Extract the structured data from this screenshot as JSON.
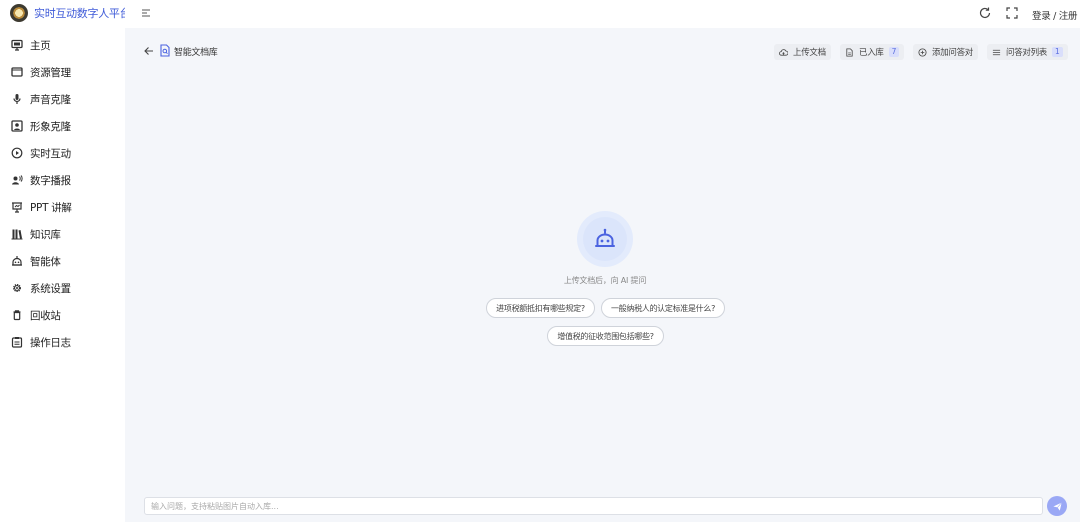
{
  "brand": {
    "name": "实时互动数字人平台",
    "color": "#3f5bd8"
  },
  "sidebar": {
    "items": [
      {
        "label": "主页",
        "icon": "monitor-icon"
      },
      {
        "label": "资源管理",
        "icon": "folder-icon"
      },
      {
        "label": "声音克隆",
        "icon": "microphone-icon"
      },
      {
        "label": "形象克隆",
        "icon": "portrait-icon"
      },
      {
        "label": "实时互动",
        "icon": "play-circle-icon"
      },
      {
        "label": "数字播报",
        "icon": "broadcast-icon"
      },
      {
        "label": "PPT 讲解",
        "icon": "presentation-icon"
      },
      {
        "label": "知识库",
        "icon": "books-icon"
      },
      {
        "label": "智能体",
        "icon": "robot-icon"
      },
      {
        "label": "系统设置",
        "icon": "gear-icon"
      },
      {
        "label": "回收站",
        "icon": "trash-icon"
      },
      {
        "label": "操作日志",
        "icon": "clipboard-icon"
      }
    ]
  },
  "header": {
    "login_label": "登录 / 注册"
  },
  "page": {
    "title": "智能文档库"
  },
  "toolbar": {
    "upload_label": "上传文档",
    "stored_label": "已入库",
    "stored_count": "7",
    "add_qa_label": "添加问答对",
    "qa_list_label": "问答对列表",
    "qa_list_count": "1"
  },
  "empty_state": {
    "hint": "上传文档后，向 AI 提问",
    "suggestions": [
      "进项税额抵扣有哪些规定?",
      "一般纳税人的认定标准是什么?",
      "增值税的征收范围包括哪些?"
    ]
  },
  "chat_input": {
    "placeholder": "输入问题，支持粘贴图片自动入库...",
    "value": ""
  },
  "colors": {
    "accent": "#5b6fe0",
    "send_button": "#9aa8f5",
    "main_bg": "#f4f6fa"
  }
}
